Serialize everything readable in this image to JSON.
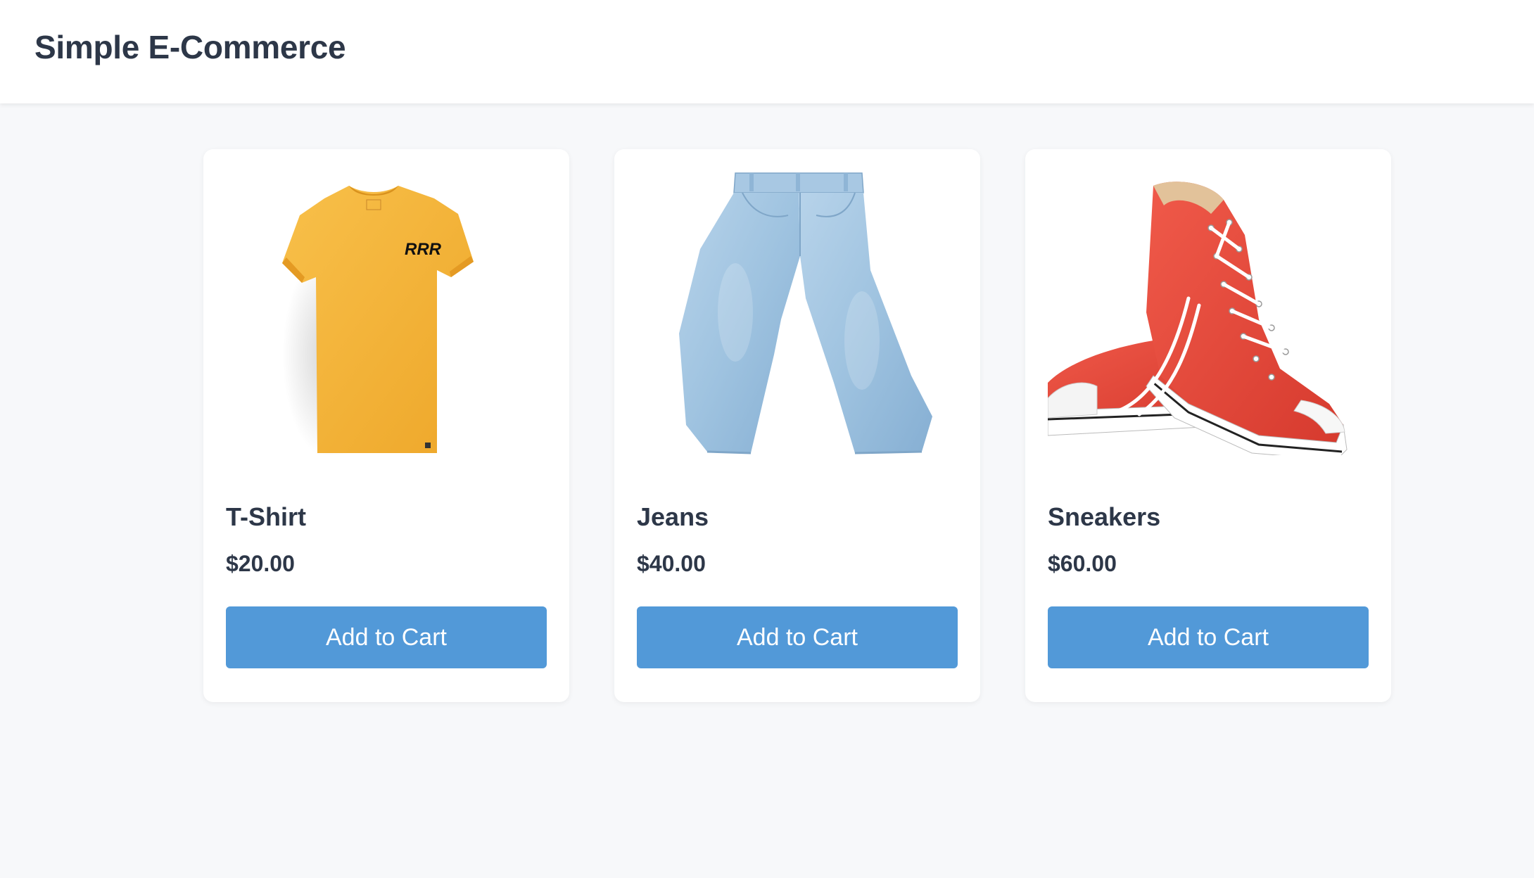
{
  "header": {
    "title": "Simple E-Commerce"
  },
  "products": [
    {
      "name": "T-Shirt",
      "price": "$20.00",
      "button_label": "Add to Cart",
      "image_icon": "t-shirt-image",
      "image_logo_text": "RRR",
      "image_color": "#f6b93b"
    },
    {
      "name": "Jeans",
      "price": "$40.00",
      "button_label": "Add to Cart",
      "image_icon": "jeans-image",
      "image_color": "#9fc3e0"
    },
    {
      "name": "Sneakers",
      "price": "$60.00",
      "button_label": "Add to Cart",
      "image_icon": "sneakers-image",
      "image_color": "#e8463a"
    }
  ],
  "colors": {
    "accent_button": "#5299d8",
    "text_primary": "#2d3748",
    "page_background": "#f7f8fa"
  }
}
